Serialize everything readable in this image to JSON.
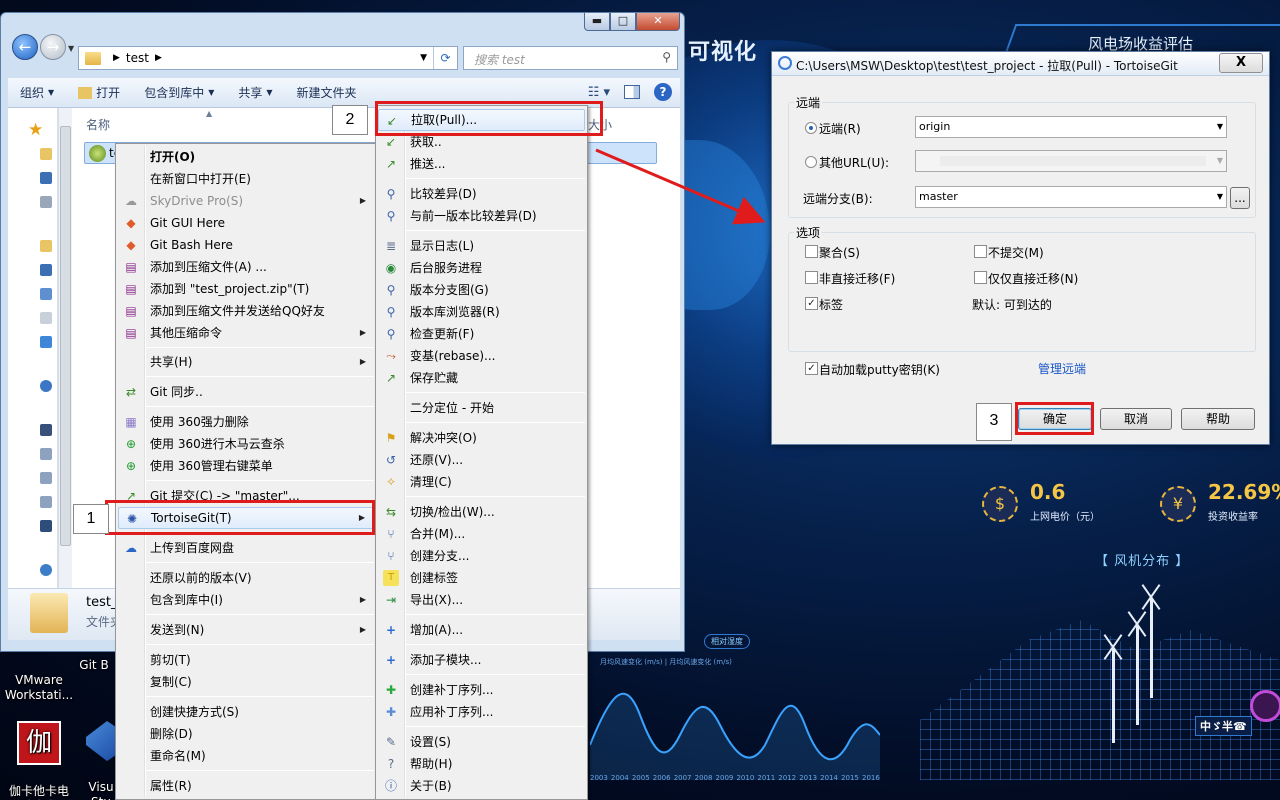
{
  "desktop": {
    "title_left": "可视化",
    "title_right": "风电场收益评估",
    "kpi1": {
      "value": "0.6",
      "label": "上网电价（元）"
    },
    "kpi2": {
      "value": "22.69%",
      "label": "投资收益率"
    },
    "section_title": "【 风机分布 】",
    "wave_legend": "月均风速变化 (m/s)  |  月均风速变化 (m/s)",
    "pill_label": "相对湿度",
    "years": [
      "2003",
      "2004",
      "2005",
      "2006",
      "2007",
      "2008",
      "2009",
      "2010",
      "2011",
      "2012",
      "2013",
      "2014",
      "2015",
      "2016"
    ],
    "badge": "中ゞ半☎",
    "icons": [
      {
        "label": "VMware\nWorkstati..."
      },
      {
        "label": "Git B"
      },
      {
        "label": "伽卡他卡电\n子教室学..."
      },
      {
        "label": "Visu\nStu"
      }
    ]
  },
  "explorer": {
    "address": {
      "crumb": "test"
    },
    "search_placeholder": "搜索 test",
    "toolbar": {
      "organize": "组织",
      "open": "打开",
      "include_library": "包含到库中",
      "share": "共享",
      "new_folder": "新建文件夹"
    },
    "columns": {
      "name": "名称",
      "size": "大小"
    },
    "file": {
      "name": "te"
    },
    "details": {
      "name": "test_",
      "type": "文件夹"
    }
  },
  "context_menu": {
    "items": [
      {
        "label": "打开(O)",
        "bold": true
      },
      {
        "label": "在新窗口中打开(E)"
      },
      {
        "label": "SkyDrive Pro(S)",
        "disabled": true,
        "submenu": true
      },
      {
        "label": "Git GUI Here"
      },
      {
        "label": "Git Bash Here"
      },
      {
        "label": "添加到压缩文件(A) ..."
      },
      {
        "label": "添加到 \"test_project.zip\"(T)"
      },
      {
        "label": "添加到压缩文件并发送给QQ好友"
      },
      {
        "label": "其他压缩命令",
        "submenu": true
      },
      {
        "label": "共享(H)",
        "submenu": true
      },
      {
        "label": "Git 同步.."
      },
      {
        "label": "使用 360强力删除"
      },
      {
        "label": "使用 360进行木马云查杀"
      },
      {
        "label": "使用 360管理右键菜单"
      },
      {
        "label": "Git 提交(C) -> \"master\"..."
      },
      {
        "label": "TortoiseGit(T)",
        "submenu": true
      },
      {
        "label": "上传到百度网盘"
      },
      {
        "label": "还原以前的版本(V)"
      },
      {
        "label": "包含到库中(I)",
        "submenu": true
      },
      {
        "label": "发送到(N)",
        "submenu": true
      },
      {
        "label": "剪切(T)"
      },
      {
        "label": "复制(C)"
      },
      {
        "label": "创建快捷方式(S)"
      },
      {
        "label": "删除(D)"
      },
      {
        "label": "重命名(M)"
      },
      {
        "label": "属性(R)"
      }
    ]
  },
  "tgit_menu": {
    "items": [
      {
        "label": "拉取(Pull)..."
      },
      {
        "label": "获取.."
      },
      {
        "label": "推送..."
      },
      {
        "label": "比较差异(D)"
      },
      {
        "label": "与前一版本比较差异(D)"
      },
      {
        "label": "显示日志(L)"
      },
      {
        "label": "后台服务进程"
      },
      {
        "label": "版本分支图(G)"
      },
      {
        "label": "版本库浏览器(R)"
      },
      {
        "label": "检查更新(F)"
      },
      {
        "label": "变基(rebase)..."
      },
      {
        "label": "保存贮藏"
      },
      {
        "label": "二分定位 - 开始"
      },
      {
        "label": "解决冲突(O)"
      },
      {
        "label": "还原(V)..."
      },
      {
        "label": "清理(C)"
      },
      {
        "label": "切换/检出(W)..."
      },
      {
        "label": "合并(M)..."
      },
      {
        "label": "创建分支..."
      },
      {
        "label": "创建标签"
      },
      {
        "label": "导出(X)..."
      },
      {
        "label": "增加(A)..."
      },
      {
        "label": "添加子模块..."
      },
      {
        "label": "创建补丁序列..."
      },
      {
        "label": "应用补丁序列..."
      },
      {
        "label": "设置(S)"
      },
      {
        "label": "帮助(H)"
      },
      {
        "label": "关于(B)"
      }
    ]
  },
  "steps": {
    "one": "1",
    "two": "2",
    "three": "3"
  },
  "dialog": {
    "title": "C:\\Users\\MSW\\Desktop\\test\\test_project - 拉取(Pull) - TortoiseGit",
    "close": "X",
    "remote_group": "远端",
    "remote_radio": "远端(R)",
    "remote_value": "origin",
    "other_url": "其他URL(U):",
    "remote_branch_label": "远端分支(B):",
    "remote_branch_value": "master",
    "browse": "...",
    "options_group": "选项",
    "opt_merge": "聚合(S)",
    "opt_no_commit": "不提交(M)",
    "opt_no_ff": "非直接迁移(F)",
    "opt_ff_only": "仅仅直接迁移(N)",
    "opt_tags": "标签",
    "opt_tags_default": "默认: 可到达的",
    "autoload_putty": "自动加载putty密钥(K)",
    "manage_remotes": "管理远端",
    "ok": "确定",
    "cancel": "取消",
    "help": "帮助"
  }
}
